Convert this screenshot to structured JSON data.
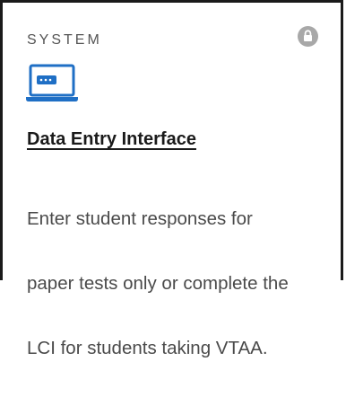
{
  "card": {
    "category": "SYSTEM",
    "title": "Data Entry Interface",
    "description_lines": [
      "Enter student responses for",
      "paper tests only or complete the",
      "LCI for students taking VTAA."
    ]
  },
  "icons": {
    "lock": "lock-icon",
    "laptop": "laptop-icon"
  },
  "colors": {
    "icon_blue": "#1f6fc5",
    "lock_gray": "#a8a8a8",
    "text_dark": "#1a1a1a",
    "text_body": "#4a4a4a"
  }
}
